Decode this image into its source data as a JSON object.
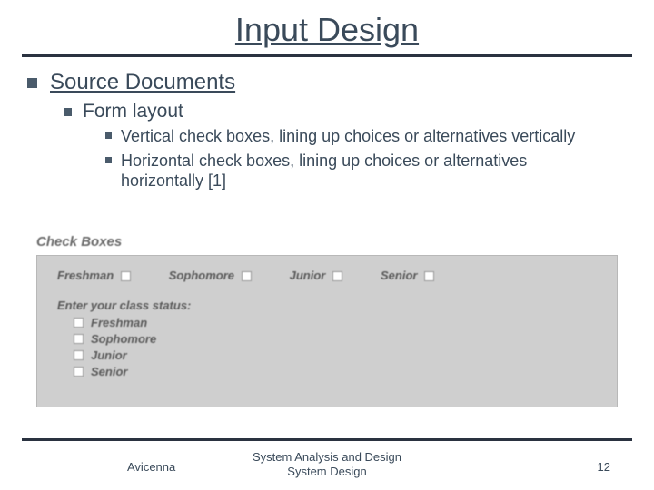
{
  "title": "Input Design",
  "outline": {
    "section": "Source Documents",
    "subsection": "Form layout",
    "points": [
      "Vertical check boxes, lining up choices or alternatives vertically",
      "Horizontal check boxes, lining up choices or alternatives horizontally  [1]"
    ]
  },
  "figure": {
    "heading": "Check Boxes",
    "horizontal_options": [
      "Freshman",
      "Sophomore",
      "Junior",
      "Senior"
    ],
    "prompt": "Enter your class status:",
    "vertical_options": [
      "Freshman",
      "Sophomore",
      "Junior",
      "Senior"
    ]
  },
  "footer": {
    "author": "Avicenna",
    "center_line1": "System Analysis and Design",
    "center_line2": "System Design",
    "page": "12"
  }
}
